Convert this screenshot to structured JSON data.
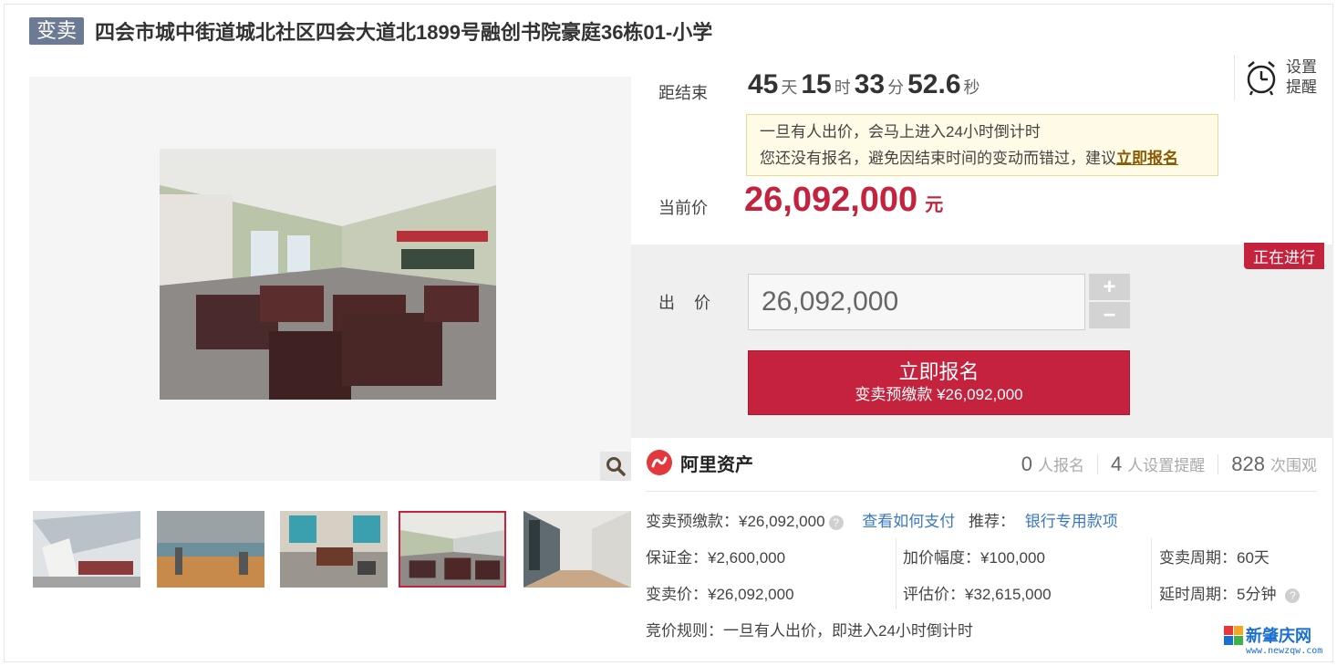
{
  "header": {
    "badge": "变卖",
    "title": "四会市城中街道城北社区四会大道北1899号融创书院豪庭36栋01-小学"
  },
  "countdown": {
    "label": "距结束",
    "days": "45",
    "days_unit": "天",
    "hours": "15",
    "hours_unit": "时",
    "minutes": "33",
    "minutes_unit": "分",
    "seconds": "52.6",
    "seconds_unit": "秒"
  },
  "reminder": {
    "line1": "设置",
    "line2": "提醒",
    "icon": "alarm-clock-icon"
  },
  "notice": {
    "line1": "一旦有人出价，会马上进入24小时倒计时",
    "line2_prefix": "您还没有报名，避免因结束时间的变动而错过，建议",
    "line2_link": "立即报名"
  },
  "current_price": {
    "label": "当前价",
    "value": "26,092,000",
    "unit": "元"
  },
  "bid": {
    "status": "正在进行",
    "label": "出 价",
    "input_value": "26,092,000",
    "plus": "+",
    "minus": "−",
    "button_main": "立即报名",
    "button_sub": "变卖预缴款 ¥26,092,000"
  },
  "brand": {
    "name": "阿里资产",
    "icon": "ali-asset-logo-icon"
  },
  "stats": {
    "signup_count": "0",
    "signup_label": "人报名",
    "remind_count": "4",
    "remind_label": "人设置提醒",
    "view_count": "828",
    "view_label": "次围观"
  },
  "details": {
    "deposit_prepay_label": "变卖预缴款：",
    "deposit_prepay_value": "¥26,092,000",
    "how_to_pay": "查看如何支付",
    "recommend_label": "推荐：",
    "recommend_link": "银行专用款项",
    "margin": "保证金：¥2,600,000",
    "increment": "加价幅度：¥100,000",
    "sale_period": "变卖周期：60天",
    "sale_price": "变卖价：¥26,092,000",
    "appraisal": "评估价：¥32,615,000",
    "delay_period": "延时周期：5分钟",
    "rule": "竞价规则：一旦有人出价，即进入24小时倒计时"
  },
  "gallery": {
    "active_thumb_index": 3,
    "thumb_count": 5
  },
  "watermark": {
    "text": "新肇庆网",
    "url": "www.newzqw.com"
  },
  "colors": {
    "accent_red": "#c4223d",
    "badge_gray": "#6d7a93",
    "link_blue": "#3a78c3"
  }
}
